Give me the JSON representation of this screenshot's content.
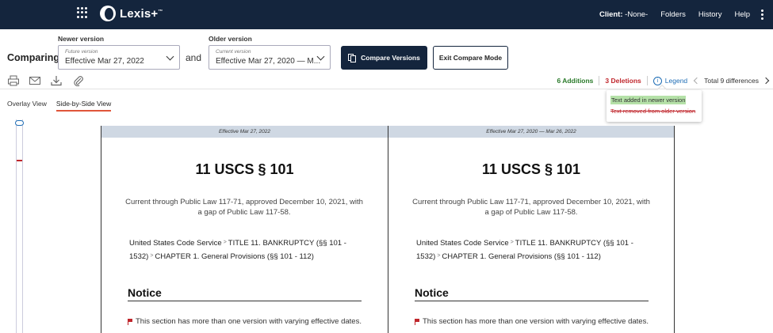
{
  "topbar": {
    "logo": "Lexis+",
    "logo_tm": "™",
    "client_label": "Client:",
    "client_value": "-None-",
    "nav": [
      "Folders",
      "History",
      "Help"
    ]
  },
  "compare": {
    "heading": "Comparing",
    "newer_label": "Newer version",
    "newer_small": "Future version",
    "newer_value": "Effective Mar 27, 2022",
    "and": "and",
    "older_label": "Older version",
    "older_small": "Current version",
    "older_value": "Effective Mar 27, 2020 — M...",
    "compare_button": "Compare Versions",
    "exit_button": "Exit Compare Mode"
  },
  "diff": {
    "additions": "6 Additions",
    "deletions": "3 Deletions",
    "legend": "Legend",
    "total": "Total 9 differences"
  },
  "legend_popup": {
    "added": "Text added in newer version",
    "removed": "Text removed from older version"
  },
  "views": {
    "overlay": "Overlay View",
    "side_by_side": "Side-by-Side View"
  },
  "panes": [
    {
      "header": "Effective Mar 27, 2022",
      "title": "11 USCS § 101",
      "current": "Current through Public Law 117-71, approved December 10, 2021, with a gap of Public Law 117-58.",
      "bc1": "United States Code Service",
      "bc2": "TITLE 11. BANKRUPTCY (§§ 101 - 1532)",
      "bc3": "CHAPTER 1. General Provisions (§§ 101 - 112)",
      "notice": "Notice",
      "note": "This section has more than one version with varying effective dates."
    },
    {
      "header": "Effective Mar 27, 2020 — Mar 26, 2022",
      "title": "11 USCS § 101",
      "current": "Current through Public Law 117-71, approved December 10, 2021, with a gap of Public Law 117-58.",
      "bc1": "United States Code Service",
      "bc2": "TITLE 11. BANKRUPTCY (§§ 101 - 1532)",
      "bc3": "CHAPTER 1. General Provisions (§§ 101 - 112)",
      "notice": "Notice",
      "note": "This section has more than one version with varying effective dates."
    }
  ],
  "icons": [
    "grid-icon",
    "print-icon",
    "email-icon",
    "download-icon",
    "attach-icon",
    "info-icon",
    "flag-icon"
  ]
}
